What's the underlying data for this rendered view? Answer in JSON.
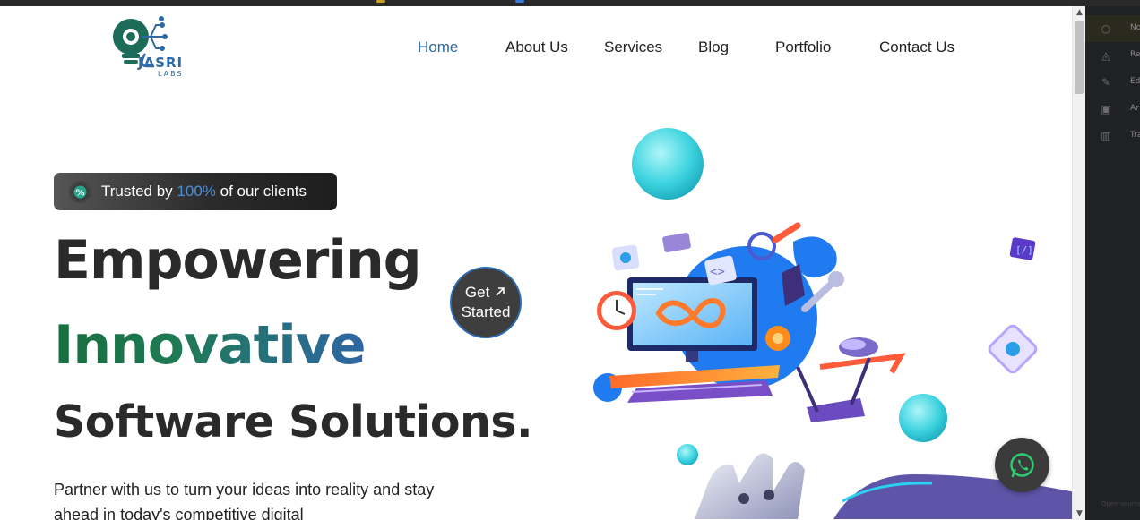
{
  "brand": {
    "name": "JASRI",
    "sub": "LABS"
  },
  "nav": {
    "items": [
      {
        "label": "Home",
        "active": true
      },
      {
        "label": "About Us"
      },
      {
        "label": "Services"
      },
      {
        "label": "Blog"
      },
      {
        "label": "Portfolio"
      },
      {
        "label": "Contact Us"
      }
    ]
  },
  "hero": {
    "badge": {
      "prefix": "Trusted by ",
      "accent": "100%",
      "suffix": " of our clients",
      "icon": "percent-icon"
    },
    "title_line1": "Empowering",
    "title_line2": "Innovative",
    "title_line3": "Software Solutions.",
    "paragraph": "Partner with us to turn your ideas into reality and stay ahead in today's competitive digital",
    "cta": {
      "line1": "Get",
      "line2": "Started",
      "icon": "arrow-up-right-icon"
    }
  },
  "whatsapp": {
    "icon": "whatsapp-icon"
  },
  "side_panel": {
    "items": [
      {
        "icon": "lightbulb-icon",
        "label": "No"
      },
      {
        "icon": "bell-icon",
        "label": "Re"
      },
      {
        "icon": "pencil-icon",
        "label": "Ed"
      },
      {
        "icon": "archive-icon",
        "label": "Ar"
      },
      {
        "icon": "trash-icon",
        "label": "Tra"
      }
    ],
    "footer": "Open-source"
  },
  "colors": {
    "brand_blue": "#2d6aa8",
    "brand_green": "#176f3d",
    "dark": "#2a2a2a"
  }
}
